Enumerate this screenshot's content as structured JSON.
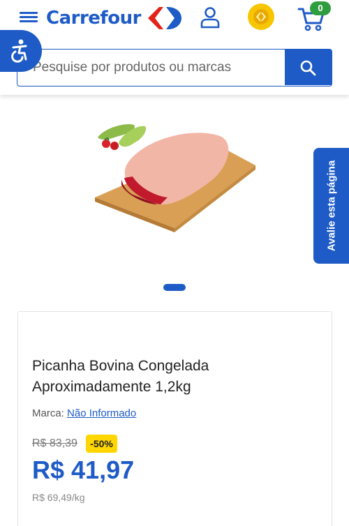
{
  "header": {
    "logo_text": "Carrefour",
    "cart_count": "0",
    "brand_color": "#1e5bc6"
  },
  "icons": {
    "menu": "hamburger-menu-icon",
    "accessibility": "accessibility-icon",
    "user": "user-icon",
    "coins": "coin-icon",
    "cart": "shopping-cart-icon",
    "search": "search-icon"
  },
  "search": {
    "placeholder": "Pesquise por produtos ou marcas"
  },
  "rate_page": {
    "label": "Avalie esta página"
  },
  "product": {
    "title": "Picanha Bovina Congelada Aproximadamente 1,2kg",
    "brand_label": "Marca:",
    "brand_value": "Não Informado",
    "old_price": "R$ 83,39",
    "discount": "-50%",
    "price": "R$ 41,97",
    "unit_price": "R$ 69,49/kg"
  },
  "colors": {
    "accent": "#1e5bc6",
    "discount_badge": "#ffd600",
    "cart_badge": "#2e9d3e"
  }
}
